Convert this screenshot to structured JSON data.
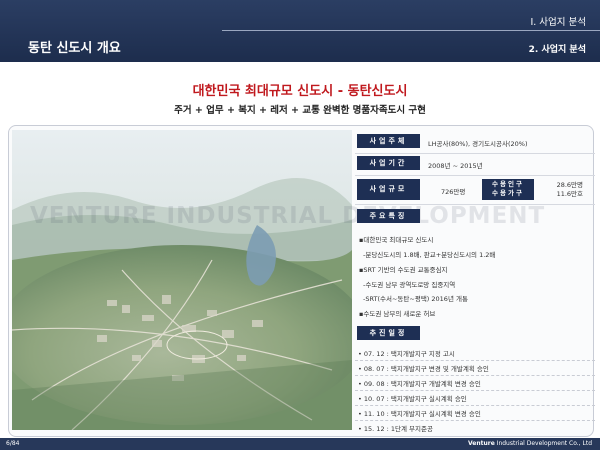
{
  "header": {
    "section": "Ⅰ. 사업지 분석",
    "title": "동탄 신도시 개요",
    "subsection": "2. 사업지 분석"
  },
  "main_title": "대한민국 최대규모 신도시 - 동탄신도시",
  "sub_title": "주거 + 업무 + 복지 + 레저 + 교통  완벽한 명품자족도시 구현",
  "watermark": "VENTURE INDUSTRIAL DEVELOPMENT",
  "info": {
    "developer_label": "사업주체",
    "developer_value": "LH공사(80%), 경기도시공사(20%)",
    "period_label": "사업기간",
    "period_value": "2008년 ~ 2015년",
    "scale_label": "사업규모",
    "scale_value": "726만평",
    "population_label_1": "수용인구",
    "population_label_2": "수용가구",
    "population_value_1": "28.6만명",
    "population_value_2": "11.6만호"
  },
  "features": {
    "label": "주요특징",
    "items": [
      {
        "text": "▪대한민국 최대규모 신도시",
        "sub": false
      },
      {
        "text": "-분당신도시의 1.8배, 판교+분당신도시의 1.2배",
        "sub": true
      },
      {
        "text": "▪SRT 기반의 수도권 교통중심지",
        "sub": false
      },
      {
        "text": "-수도권 남부 광역도로망 집중지역",
        "sub": true
      },
      {
        "text": "-SRT(수서~동탄~평택) 2016년 개통",
        "sub": true
      },
      {
        "text": "▪수도권 남부의 새로운 허브",
        "sub": false
      }
    ]
  },
  "schedule": {
    "label": "추진일정",
    "items": [
      "• 07. 12 : 택지개발지구 지정 고시",
      "• 08. 07 : 택지개발지구 변경 및 개발계획 승인",
      "• 09. 08 : 택지개발지구 개발계획 변경 승인",
      "• 10. 07 : 택지개발지구 실시계획 승인",
      "• 11. 10 : 택지개발지구 실시계획 변경 승인",
      "• 15. 12 : 1단계 부지준공"
    ]
  },
  "footer": {
    "page": "6/84",
    "company_bold": "Venture",
    "company_rest": " Industrial Development Co., Ltd"
  },
  "colors": {
    "navy": "#1e2f54",
    "title_red": "#c0191e"
  }
}
